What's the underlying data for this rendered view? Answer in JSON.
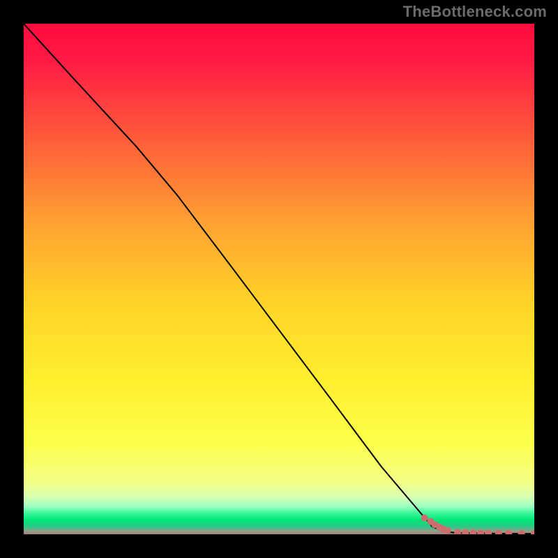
{
  "watermark": "TheBottleneck.com",
  "chart_data": {
    "type": "line",
    "title": "",
    "xlabel": "",
    "ylabel": "",
    "xlim": [
      0,
      100
    ],
    "ylim": [
      0,
      100
    ],
    "grid": false,
    "legend": false,
    "background_gradient": {
      "top": "#ff1744",
      "mid": "#ffd600",
      "green_band": "#00e676",
      "bottom_line": "#b27b7b"
    },
    "series": [
      {
        "name": "curve",
        "type": "line",
        "color": "#000000",
        "x": [
          0,
          10,
          22,
          30,
          40,
          50,
          60,
          70,
          80,
          82.5,
          85,
          90,
          95,
          100
        ],
        "y": [
          100,
          89,
          76,
          66.5,
          53.3,
          40,
          26.7,
          13.3,
          1.5,
          0.5,
          0.25,
          0.18,
          0.12,
          0.1
        ]
      },
      {
        "name": "markers",
        "type": "scatter",
        "color": "#cc6e6e",
        "x": [
          78.5,
          79.7,
          80.5,
          81.4,
          82.2,
          83.0,
          85.0,
          86.5,
          88.0,
          89.5,
          91.0,
          93.0,
          95.0,
          97.5,
          100.0
        ],
        "y": [
          3.2,
          2.5,
          1.9,
          1.4,
          1.0,
          0.7,
          0.35,
          0.3,
          0.28,
          0.25,
          0.22,
          0.2,
          0.18,
          0.14,
          0.1
        ]
      }
    ]
  }
}
